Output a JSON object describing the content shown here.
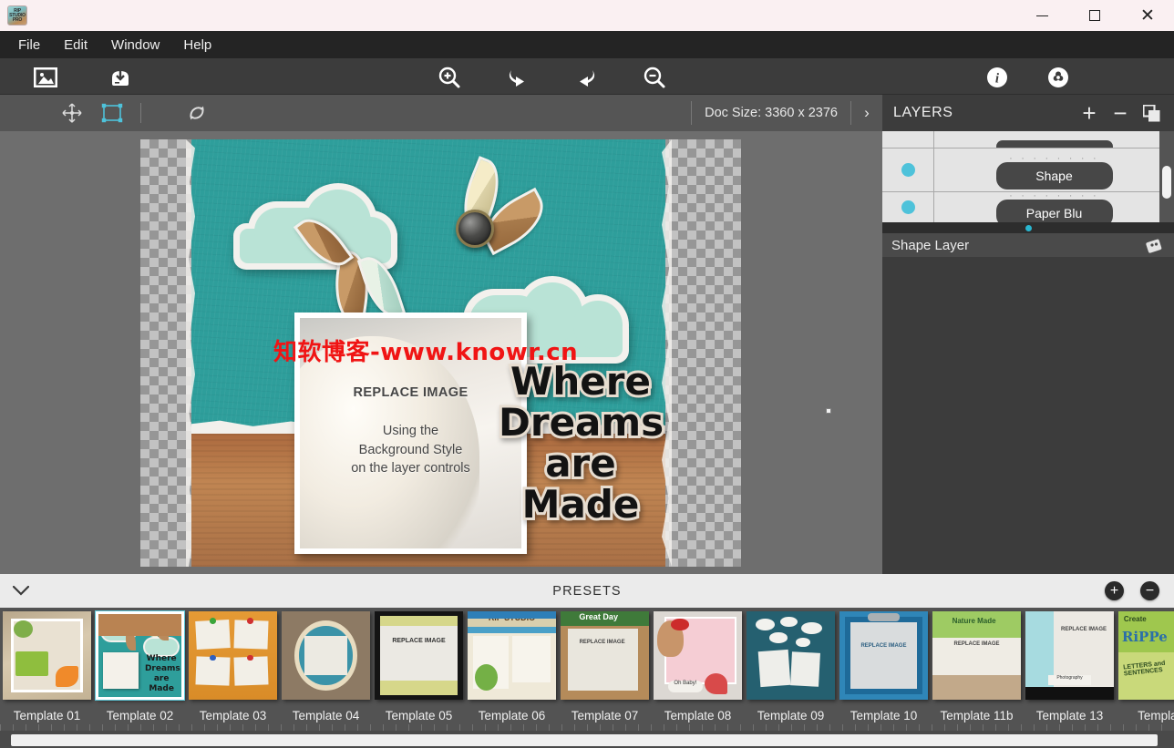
{
  "window": {
    "app_name": "RIP STUDIO PRO",
    "app_icon": "rip-studio-app-icon",
    "minimize_label": "−",
    "maximize_label": "□",
    "close_label": "✕"
  },
  "menubar": {
    "items": [
      {
        "label": "File"
      },
      {
        "label": "Edit"
      },
      {
        "label": "Window"
      },
      {
        "label": "Help"
      }
    ]
  },
  "toolbar": {
    "items": [
      {
        "name": "open-image-icon",
        "title": "Open Image"
      },
      {
        "name": "save-image-icon",
        "title": "Save Image"
      },
      {
        "name": "zoom-in-icon",
        "title": "Zoom In"
      },
      {
        "name": "undo-icon",
        "title": "Undo"
      },
      {
        "name": "redo-icon",
        "title": "Redo"
      },
      {
        "name": "zoom-out-icon",
        "title": "Zoom Out"
      },
      {
        "name": "info-icon",
        "title": "Info"
      },
      {
        "name": "settings-icon",
        "title": "Settings"
      }
    ]
  },
  "options_bar": {
    "tools": [
      {
        "name": "move-tool-icon",
        "active": false
      },
      {
        "name": "transform-tool-icon",
        "active": true
      },
      {
        "name": "reset-rotate-tool-icon",
        "active": false
      }
    ],
    "doc_size_label": "Doc Size: 3360 x 2376",
    "expand_chevron": "›"
  },
  "canvas": {
    "photo_title": "REPLACE IMAGE",
    "photo_sub_line1": "Using the",
    "photo_sub_line2": "Background Style",
    "photo_sub_line3": "on the layer controls",
    "headline_line1": "Where",
    "headline_line2": "Dreams",
    "headline_line3": "are",
    "headline_line4": "Made",
    "watermark": "知软博客-www.knowr.cn",
    "watermark_color": "#f01414",
    "paper_color": "#2e9e9b",
    "cloud_color": "#b9e3d6",
    "cardboard_color": "#c08552"
  },
  "layers": {
    "title": "LAYERS",
    "add_label": "+",
    "remove_label": "−",
    "duplicate_icon": "duplicate-layer-icon",
    "rows": [
      {
        "name": "",
        "partial": "top",
        "visible": true
      },
      {
        "name": "Shape",
        "partial": "none",
        "visible": true,
        "selected": true
      },
      {
        "name": "Paper Blu",
        "partial": "bottom",
        "visible": true
      }
    ],
    "footer_label": "Shape Layer",
    "footer_icon": "layer-style-icon"
  },
  "presets": {
    "title": "PRESETS",
    "collapse_chevron": "⌄",
    "add_label": "+",
    "remove_label": "−",
    "items": [
      {
        "label": "Template 01",
        "selected": false
      },
      {
        "label": "Template 02",
        "selected": true
      },
      {
        "label": "Template 03",
        "selected": false
      },
      {
        "label": "Template 04",
        "selected": false
      },
      {
        "label": "Template 05",
        "selected": false
      },
      {
        "label": "Template 06",
        "selected": false
      },
      {
        "label": "Template 07",
        "selected": false
      },
      {
        "label": "Template 08",
        "selected": false
      },
      {
        "label": "Template 09",
        "selected": false
      },
      {
        "label": "Template 10",
        "selected": false
      },
      {
        "label": "Template 11b",
        "selected": false
      },
      {
        "label": "Template 13",
        "selected": false
      },
      {
        "label": "Template",
        "selected": false
      }
    ]
  }
}
